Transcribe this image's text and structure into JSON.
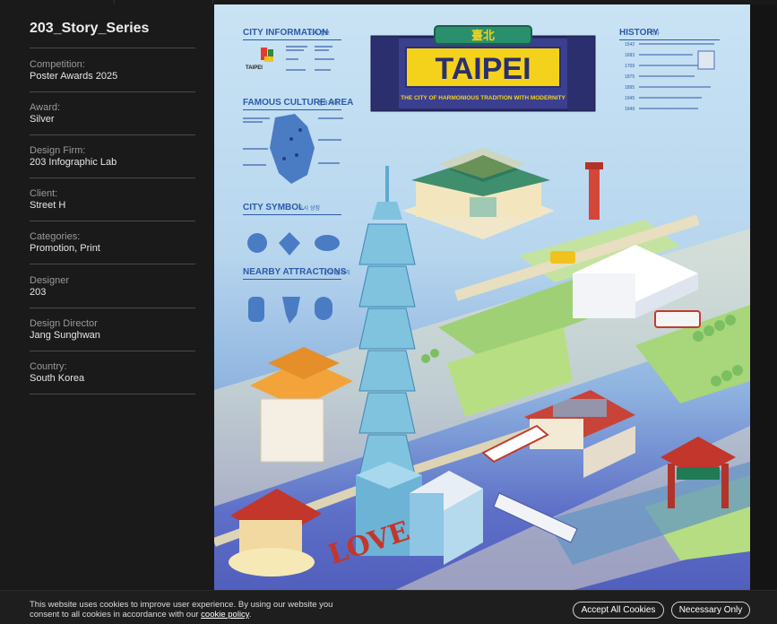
{
  "project": {
    "title": "203_Story_Series"
  },
  "details": [
    {
      "label": "Competition:",
      "value": "Poster Awards 2025"
    },
    {
      "label": "Award:",
      "value": "Silver"
    },
    {
      "label": "Design Firm:",
      "value": "203 Infographic Lab"
    },
    {
      "label": "Client:",
      "value": "Street H"
    },
    {
      "label": "Categories:",
      "value": "Promotion, Print"
    },
    {
      "label": "Designer",
      "value": "203"
    },
    {
      "label": "Design Director",
      "value": "Jang Sunghwan"
    },
    {
      "label": "Country:",
      "value": "South Korea"
    }
  ],
  "poster": {
    "hanja_title": "臺北",
    "main_title": "TAIPEI",
    "subtitle": "THE CITY OF HARMONIOUS TRADITION WITH MODERNITY",
    "logo_text": "TAIPEI",
    "sections": {
      "city_information": "CITY INFORMATION",
      "city_information_ko": "도시 정보",
      "famous_culture_area": "FAMOUS CULTURE AREA",
      "famous_culture_area_ko": "문화지역",
      "city_symbol": "CITY SYMBOL",
      "city_symbol_ko": "도시 상징",
      "nearby_attractions": "NEARBY ATTRACTIONS",
      "nearby_attractions_ko": "근교 볼거리",
      "history": "HISTORY",
      "history_ko": "역사"
    },
    "history_years": [
      "1542",
      "1683",
      "1709",
      "1875",
      "1895",
      "1945",
      "1949"
    ],
    "love_sign": "LOVE",
    "colors": {
      "sky_top": "#c9e3f4",
      "sky_bottom": "#4d58b8",
      "title_yellow": "#f4d21c",
      "title_panel": "#3b3f8f",
      "heading_blue": "#2d5aa8",
      "roof_red": "#c2362b",
      "roof_orange": "#f2a33a",
      "tower_teal": "#7fc3df",
      "grass": "#b7dd7a"
    }
  },
  "cookie_banner": {
    "text": "This website uses cookies to improve user experience. By using our website you consent to all cookies in accordance with our",
    "link": "cookie policy",
    "suffix": ".",
    "accept_all": "Accept All Cookies",
    "necessary_only": "Necessary Only"
  }
}
